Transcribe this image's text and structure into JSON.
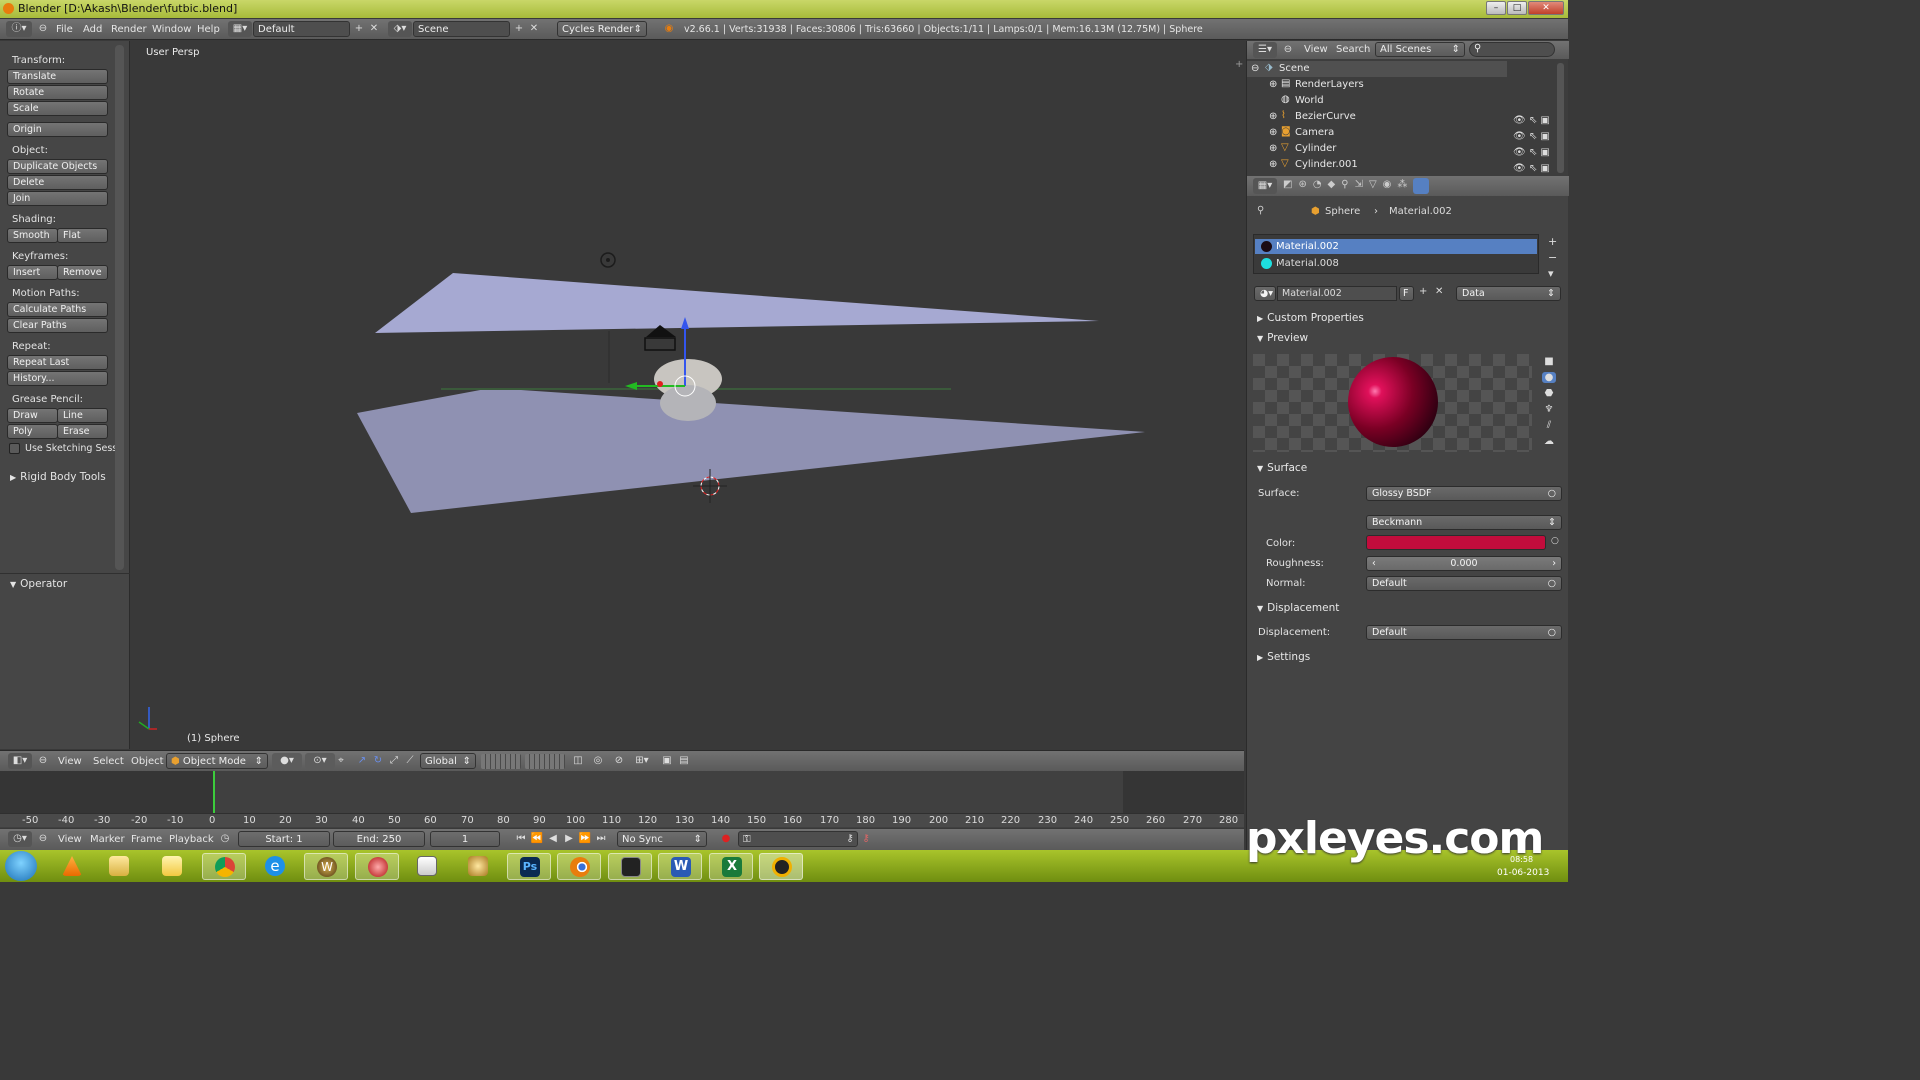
{
  "window": {
    "title": "Blender [D:\\Akash\\Blender\\futbic.blend]"
  },
  "infobar": {
    "menus": [
      "File",
      "Add",
      "Render",
      "Window",
      "Help"
    ],
    "screen_layout": "Default",
    "scene": "Scene",
    "engine": "Cycles Render",
    "stats": "v2.66.1 | Verts:31938 | Faces:30806 | Tris:63660 | Objects:1/11 | Lamps:0/1 | Mem:16.13M (12.75M) | Sphere"
  },
  "toolshelf": {
    "transform_label": "Transform:",
    "translate": "Translate",
    "rotate": "Rotate",
    "scale": "Scale",
    "origin": "Origin",
    "object_label": "Object:",
    "duplicate": "Duplicate Objects",
    "delete": "Delete",
    "join": "Join",
    "shading_label": "Shading:",
    "smooth": "Smooth",
    "flat": "Flat",
    "keyframes_label": "Keyframes:",
    "insert": "Insert",
    "remove": "Remove",
    "motion_label": "Motion Paths:",
    "calc_paths": "Calculate Paths",
    "clear_paths": "Clear Paths",
    "repeat_label": "Repeat:",
    "repeat_last": "Repeat Last",
    "history": "History...",
    "grease_label": "Grease Pencil:",
    "draw": "Draw",
    "line": "Line",
    "poly": "Poly",
    "erase": "Erase",
    "sketching": "Use Sketching Sessi",
    "rigid_body": "Rigid Body Tools",
    "operator": "Operator"
  },
  "viewport": {
    "view_name": "User Persp",
    "object_info": "(1) Sphere"
  },
  "viewhdr": {
    "menus": [
      "View",
      "Select",
      "Object"
    ],
    "mode": "Object Mode",
    "orientation": "Global"
  },
  "timeline": {
    "ticks": [
      "-50",
      "-40",
      "-30",
      "-20",
      "-10",
      "0",
      "10",
      "20",
      "30",
      "40",
      "50",
      "60",
      "70",
      "80",
      "90",
      "100",
      "110",
      "120",
      "130",
      "140",
      "150",
      "160",
      "170",
      "180",
      "190",
      "200",
      "210",
      "220",
      "230",
      "240",
      "250",
      "260",
      "270",
      "280"
    ],
    "menus": [
      "View",
      "Marker",
      "Frame",
      "Playback"
    ],
    "start": "Start: 1",
    "end": "End: 250",
    "current": "1",
    "sync": "No Sync"
  },
  "outliner": {
    "view": "View",
    "search": "Search",
    "filter": "All Scenes",
    "items": [
      "Scene",
      "RenderLayers",
      "World",
      "BezierCurve",
      "Camera",
      "Cylinder",
      "Cylinder.001"
    ]
  },
  "properties": {
    "breadcrumb_object": "Sphere",
    "breadcrumb_material": "Material.002",
    "slots": [
      {
        "name": "Material.002",
        "color": "#1a0a14"
      },
      {
        "name": "Material.008",
        "color": "#1ee0e0"
      }
    ],
    "material_name": "Material.002",
    "fake_user": "F",
    "link": "Data",
    "custom_props": "Custom Properties",
    "preview": "Preview",
    "surface_hdr": "Surface",
    "surface_label": "Surface:",
    "surface_value": "Glossy BSDF",
    "distribution": "Beckmann",
    "color_label": "Color:",
    "color_value": "#c20c3c",
    "roughness_label": "Roughness:",
    "roughness_value": "0.000",
    "normal_label": "Normal:",
    "normal_value": "Default",
    "displacement_hdr": "Displacement",
    "displacement_label": "Displacement:",
    "displacement_value": "Default",
    "settings": "Settings"
  },
  "taskbar": {
    "clock_time": "08:58",
    "clock_date": "01-06-2013"
  },
  "watermark": "pxleyes.com"
}
